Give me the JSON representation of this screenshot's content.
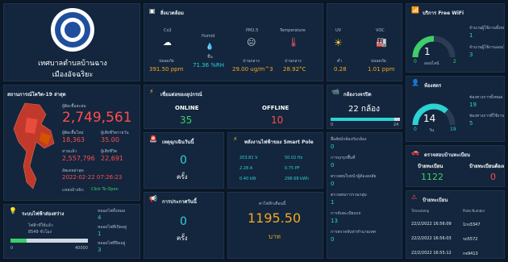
{
  "municipality": {
    "line1": "เทศบาลตำบลบ้านฉาง",
    "line2": "เมืองอัจฉริยะ"
  },
  "environment": {
    "title": "สิ่งแวดล้อม",
    "co2": {
      "label": "Co2",
      "status": "ปลอดภัย",
      "value": "391.50 ppm"
    },
    "humid": {
      "label": "Humid",
      "status": "ชื้น",
      "value": "71.36 %RH"
    },
    "pm25": {
      "label": "PM2.5",
      "status": "ปานกลาง",
      "value": "29.00 ug/m^3"
    },
    "temperature": {
      "label": "Temperature",
      "status": "ปานกลาง",
      "value": "28.92°C"
    },
    "uv": {
      "label": "UV",
      "status": "ต่ำ",
      "value": "0.28"
    },
    "voc": {
      "label": "VOC",
      "status": "ปลอดภัย",
      "value": "1.01 ppm"
    }
  },
  "wifi": {
    "title": "บริการ Free WiFi",
    "count": "1",
    "count_label": "ออนไลน์",
    "gauge_min": "0",
    "gauge_max": "2",
    "gauge_value": 1,
    "users_today_label": "จำนวนผู้ใช้งานทั้งหมด",
    "users_today": "1",
    "users_online_label": "จำนวนผู้ใช้งานออนไล",
    "users_online": "3"
  },
  "covid": {
    "title": "สถานการณ์โควิด-19 ล่าสุด",
    "confirmed_label": "ผู้ติดเชื้อสะสม",
    "confirmed": "2,749,561",
    "new_label": "ผู้ติดเชื้อใหม่",
    "new": "18,363",
    "deaths_label": "ผู้เสียชีวิตรายวัน",
    "deaths": "35.00",
    "recovered_label": "หายแล้ว",
    "recovered": "2,557,796",
    "total_deaths_label": "ผู้เสียชีวิต",
    "total_deaths": "22,691",
    "updated_label": "อัพเดทล่าสุด",
    "updated": "2022-02-22 07:26:23",
    "source_label": "แหล่งอ้างอิง:",
    "source_link": "Click To Open"
  },
  "devices": {
    "title": "เชื่อมต่อของอุปกรณ์",
    "online_label": "ONLINE",
    "online": "35",
    "offline_label": "OFFLINE",
    "offline": "10"
  },
  "cctv": {
    "title": "กล้องวงจรปิด",
    "count": "22 กล้อง",
    "bar_min": "0",
    "bar_max": "24",
    "fraction": 0.92
  },
  "cctv_stats": {
    "rows": [
      {
        "label": "สื่อสัยบ์กล้องกับกล้อง",
        "value": "0"
      },
      {
        "label": "การบุกรุกพื้นที่",
        "value": "0"
      },
      {
        "label": "ตรวจพบใบหน้าผู้ต้องสงสัย",
        "value": "0"
      },
      {
        "label": "ตรวจพบการรวมกลุ่ม",
        "value": "1"
      },
      {
        "label": "การจับทะเบียนรถ",
        "value": "13"
      },
      {
        "label": "การตรวจจับท่าทำนายเทศ",
        "value": "0"
      }
    ]
  },
  "aqi": {
    "title": "ห้องสตร",
    "count": "14",
    "gauge_min": "0",
    "gauge_max": "19",
    "gauge_value": 14,
    "unit": "วัน",
    "label1": "ช่องทางการทั้งหมด",
    "value1": "19",
    "label2": "ช่องทางการที่ใช้งาน",
    "value2": "5"
  },
  "emergency": {
    "title": "เหตุฉุกเฉินวันนี้",
    "count": "0",
    "unit": "ครั้ง"
  },
  "smartpole": {
    "title": "พลังงานไฟฟ้าของ Smart Pole",
    "readings": [
      [
        "203.81 V",
        "50.02 Hz"
      ],
      [
        "2.28 A",
        "0.75 PF"
      ],
      [
        "0.40 kW",
        "298.68 kWh"
      ]
    ]
  },
  "lights": {
    "title": "ระบบไฟฟ้าส่องสว่าง",
    "used_label": "ไฟฟ้าที่ใช้แล้ว",
    "used": "8549 ชั่วโมง",
    "bar_min": "0",
    "bar_max": "40000",
    "fraction": 0.21,
    "all_label": "หลอดไฟทั้งหมด",
    "all": "4",
    "on_label": "หลอดไฟที่เปิดอยู่",
    "on": "1",
    "off_label": "หลอดไฟที่ปิดอยู่",
    "off": "3"
  },
  "announce": {
    "title": "การประกาศวันนี้",
    "count": "0",
    "unit": "ครั้ง"
  },
  "electric": {
    "label": "ค่าไฟฟ้าเดือนนี้",
    "value": "1195.50",
    "unit": "บาท"
  },
  "visitors": {
    "title": "ตรวจสอบบ้านทะเบียน",
    "today_label": "ป้ายทะเบียน",
    "today": "1122",
    "blocked_label": "ป้ายทะเบียนต้องสงสัย",
    "blocked": "0"
  },
  "plates": {
    "title": "ป้ายทะเบียน",
    "col1": "Timestamp",
    "col2": "Plate Number",
    "rows": [
      {
        "time": "22/2/2022 16:56:09",
        "plate": "1กง3347"
      },
      {
        "time": "22/2/2022 16:56:03",
        "plate": "รถ5572"
      },
      {
        "time": "22/2/2022 16:55:12",
        "plate": "กจ9413"
      }
    ]
  },
  "colors": {
    "bg": "#0b1726",
    "panel": "#13263d",
    "accent_orange": "#f5a623",
    "accent_red": "#ff4d4d",
    "accent_cyan": "#2bd3d3",
    "accent_green": "#3ecf6a"
  }
}
